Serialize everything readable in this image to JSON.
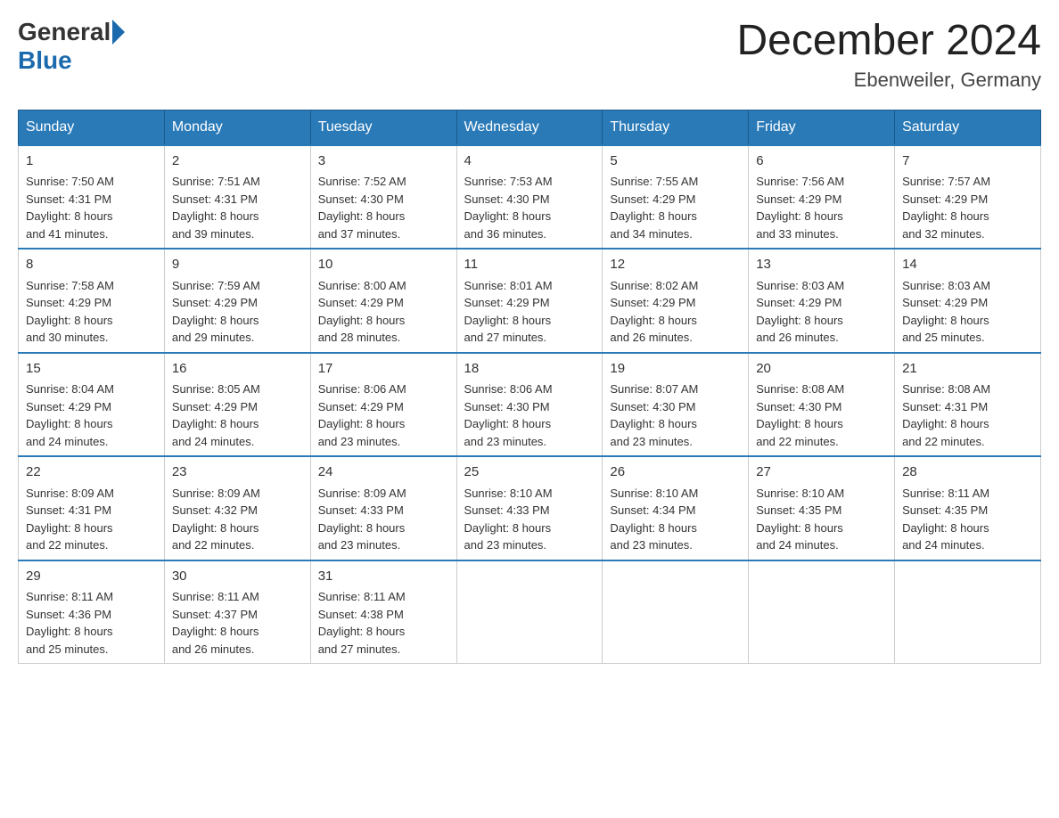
{
  "header": {
    "logo_general": "General",
    "logo_blue": "Blue",
    "month_title": "December 2024",
    "location": "Ebenweiler, Germany"
  },
  "days_of_week": [
    "Sunday",
    "Monday",
    "Tuesday",
    "Wednesday",
    "Thursday",
    "Friday",
    "Saturday"
  ],
  "weeks": [
    [
      {
        "day": "1",
        "sunrise": "Sunrise: 7:50 AM",
        "sunset": "Sunset: 4:31 PM",
        "daylight": "Daylight: 8 hours",
        "daylight2": "and 41 minutes."
      },
      {
        "day": "2",
        "sunrise": "Sunrise: 7:51 AM",
        "sunset": "Sunset: 4:31 PM",
        "daylight": "Daylight: 8 hours",
        "daylight2": "and 39 minutes."
      },
      {
        "day": "3",
        "sunrise": "Sunrise: 7:52 AM",
        "sunset": "Sunset: 4:30 PM",
        "daylight": "Daylight: 8 hours",
        "daylight2": "and 37 minutes."
      },
      {
        "day": "4",
        "sunrise": "Sunrise: 7:53 AM",
        "sunset": "Sunset: 4:30 PM",
        "daylight": "Daylight: 8 hours",
        "daylight2": "and 36 minutes."
      },
      {
        "day": "5",
        "sunrise": "Sunrise: 7:55 AM",
        "sunset": "Sunset: 4:29 PM",
        "daylight": "Daylight: 8 hours",
        "daylight2": "and 34 minutes."
      },
      {
        "day": "6",
        "sunrise": "Sunrise: 7:56 AM",
        "sunset": "Sunset: 4:29 PM",
        "daylight": "Daylight: 8 hours",
        "daylight2": "and 33 minutes."
      },
      {
        "day": "7",
        "sunrise": "Sunrise: 7:57 AM",
        "sunset": "Sunset: 4:29 PM",
        "daylight": "Daylight: 8 hours",
        "daylight2": "and 32 minutes."
      }
    ],
    [
      {
        "day": "8",
        "sunrise": "Sunrise: 7:58 AM",
        "sunset": "Sunset: 4:29 PM",
        "daylight": "Daylight: 8 hours",
        "daylight2": "and 30 minutes."
      },
      {
        "day": "9",
        "sunrise": "Sunrise: 7:59 AM",
        "sunset": "Sunset: 4:29 PM",
        "daylight": "Daylight: 8 hours",
        "daylight2": "and 29 minutes."
      },
      {
        "day": "10",
        "sunrise": "Sunrise: 8:00 AM",
        "sunset": "Sunset: 4:29 PM",
        "daylight": "Daylight: 8 hours",
        "daylight2": "and 28 minutes."
      },
      {
        "day": "11",
        "sunrise": "Sunrise: 8:01 AM",
        "sunset": "Sunset: 4:29 PM",
        "daylight": "Daylight: 8 hours",
        "daylight2": "and 27 minutes."
      },
      {
        "day": "12",
        "sunrise": "Sunrise: 8:02 AM",
        "sunset": "Sunset: 4:29 PM",
        "daylight": "Daylight: 8 hours",
        "daylight2": "and 26 minutes."
      },
      {
        "day": "13",
        "sunrise": "Sunrise: 8:03 AM",
        "sunset": "Sunset: 4:29 PM",
        "daylight": "Daylight: 8 hours",
        "daylight2": "and 26 minutes."
      },
      {
        "day": "14",
        "sunrise": "Sunrise: 8:03 AM",
        "sunset": "Sunset: 4:29 PM",
        "daylight": "Daylight: 8 hours",
        "daylight2": "and 25 minutes."
      }
    ],
    [
      {
        "day": "15",
        "sunrise": "Sunrise: 8:04 AM",
        "sunset": "Sunset: 4:29 PM",
        "daylight": "Daylight: 8 hours",
        "daylight2": "and 24 minutes."
      },
      {
        "day": "16",
        "sunrise": "Sunrise: 8:05 AM",
        "sunset": "Sunset: 4:29 PM",
        "daylight": "Daylight: 8 hours",
        "daylight2": "and 24 minutes."
      },
      {
        "day": "17",
        "sunrise": "Sunrise: 8:06 AM",
        "sunset": "Sunset: 4:29 PM",
        "daylight": "Daylight: 8 hours",
        "daylight2": "and 23 minutes."
      },
      {
        "day": "18",
        "sunrise": "Sunrise: 8:06 AM",
        "sunset": "Sunset: 4:30 PM",
        "daylight": "Daylight: 8 hours",
        "daylight2": "and 23 minutes."
      },
      {
        "day": "19",
        "sunrise": "Sunrise: 8:07 AM",
        "sunset": "Sunset: 4:30 PM",
        "daylight": "Daylight: 8 hours",
        "daylight2": "and 23 minutes."
      },
      {
        "day": "20",
        "sunrise": "Sunrise: 8:08 AM",
        "sunset": "Sunset: 4:30 PM",
        "daylight": "Daylight: 8 hours",
        "daylight2": "and 22 minutes."
      },
      {
        "day": "21",
        "sunrise": "Sunrise: 8:08 AM",
        "sunset": "Sunset: 4:31 PM",
        "daylight": "Daylight: 8 hours",
        "daylight2": "and 22 minutes."
      }
    ],
    [
      {
        "day": "22",
        "sunrise": "Sunrise: 8:09 AM",
        "sunset": "Sunset: 4:31 PM",
        "daylight": "Daylight: 8 hours",
        "daylight2": "and 22 minutes."
      },
      {
        "day": "23",
        "sunrise": "Sunrise: 8:09 AM",
        "sunset": "Sunset: 4:32 PM",
        "daylight": "Daylight: 8 hours",
        "daylight2": "and 22 minutes."
      },
      {
        "day": "24",
        "sunrise": "Sunrise: 8:09 AM",
        "sunset": "Sunset: 4:33 PM",
        "daylight": "Daylight: 8 hours",
        "daylight2": "and 23 minutes."
      },
      {
        "day": "25",
        "sunrise": "Sunrise: 8:10 AM",
        "sunset": "Sunset: 4:33 PM",
        "daylight": "Daylight: 8 hours",
        "daylight2": "and 23 minutes."
      },
      {
        "day": "26",
        "sunrise": "Sunrise: 8:10 AM",
        "sunset": "Sunset: 4:34 PM",
        "daylight": "Daylight: 8 hours",
        "daylight2": "and 23 minutes."
      },
      {
        "day": "27",
        "sunrise": "Sunrise: 8:10 AM",
        "sunset": "Sunset: 4:35 PM",
        "daylight": "Daylight: 8 hours",
        "daylight2": "and 24 minutes."
      },
      {
        "day": "28",
        "sunrise": "Sunrise: 8:11 AM",
        "sunset": "Sunset: 4:35 PM",
        "daylight": "Daylight: 8 hours",
        "daylight2": "and 24 minutes."
      }
    ],
    [
      {
        "day": "29",
        "sunrise": "Sunrise: 8:11 AM",
        "sunset": "Sunset: 4:36 PM",
        "daylight": "Daylight: 8 hours",
        "daylight2": "and 25 minutes."
      },
      {
        "day": "30",
        "sunrise": "Sunrise: 8:11 AM",
        "sunset": "Sunset: 4:37 PM",
        "daylight": "Daylight: 8 hours",
        "daylight2": "and 26 minutes."
      },
      {
        "day": "31",
        "sunrise": "Sunrise: 8:11 AM",
        "sunset": "Sunset: 4:38 PM",
        "daylight": "Daylight: 8 hours",
        "daylight2": "and 27 minutes."
      },
      null,
      null,
      null,
      null
    ]
  ]
}
